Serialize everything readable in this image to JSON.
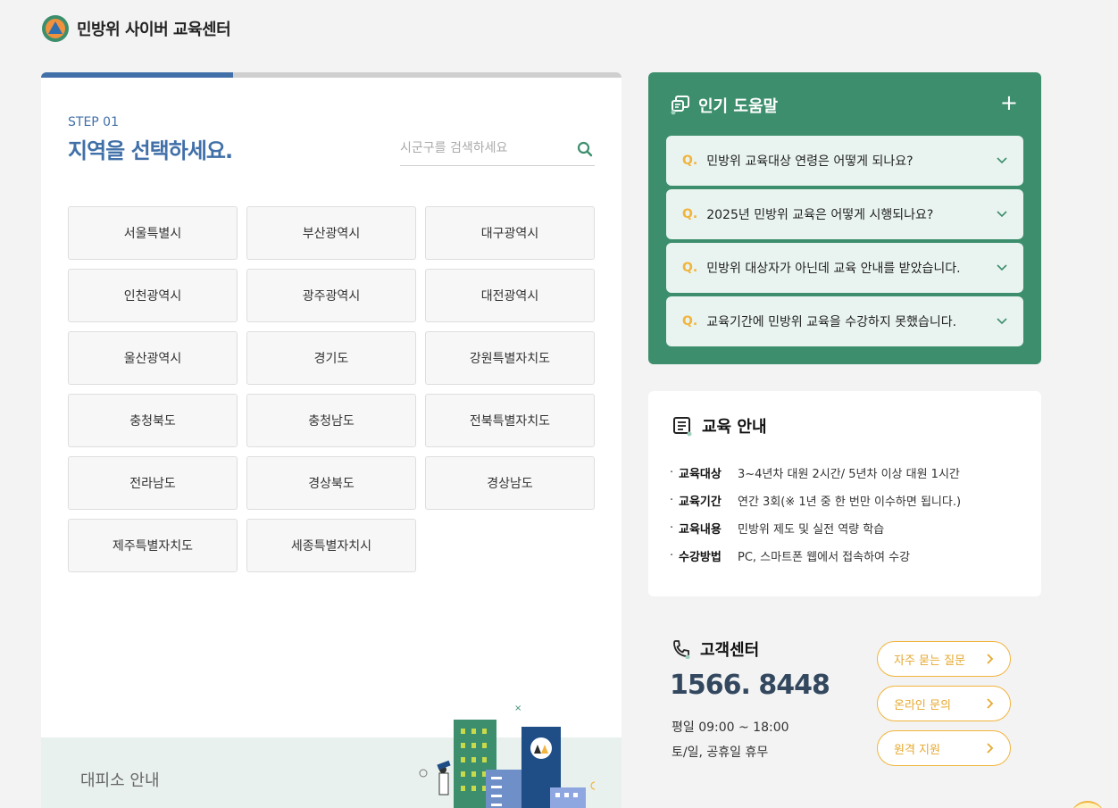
{
  "header": {
    "title": "민방위 사이버 교육센터"
  },
  "step": {
    "label": "STEP 01",
    "title": "지역을 선택하세요.",
    "progress_fraction": 0.33
  },
  "search": {
    "placeholder": "시군구를 검색하세요"
  },
  "regions": [
    "서울특별시",
    "부산광역시",
    "대구광역시",
    "인천광역시",
    "광주광역시",
    "대전광역시",
    "울산광역시",
    "경기도",
    "강원특별자치도",
    "충청북도",
    "충청남도",
    "전북특별자치도",
    "전라남도",
    "경상북도",
    "경상남도",
    "제주특별자치도",
    "세종특별자치시"
  ],
  "office": {
    "label": "대피소 안내"
  },
  "faq": {
    "title": "인기 도움말",
    "q_mark": "Q.",
    "items": [
      "민방위 교육대상 연령은 어떻게 되나요?",
      "2025년 민방위 교육은 어떻게 시행되나요?",
      "민방위 대상자가 아닌데 교육 안내를 받았습니다.",
      "교육기간에 민방위 교육을 수강하지 못했습니다."
    ]
  },
  "edu": {
    "title": "교육 안내",
    "rows": [
      {
        "key": "교육대상",
        "value": "3~4년차 대원 2시간/ 5년차 이상 대원 1시간"
      },
      {
        "key": "교육기간",
        "value": "연간 3회(※ 1년 중 한 번만 이수하면 됩니다.)"
      },
      {
        "key": "교육내용",
        "value": "민방위 제도 및 실전 역량 학습"
      },
      {
        "key": "수강방법",
        "value": "PC, 스마트폰 웹에서 접속하여 수강"
      }
    ]
  },
  "customer": {
    "title": "고객센터",
    "phone": "1566. 8448",
    "hours_weekday": "평일 09:00 ~ 18:00",
    "hours_weekend": "토/일, 공휴일 휴무",
    "links": [
      "자주 묻는 질문",
      "온라인 문의",
      "원격 지원"
    ]
  },
  "colors": {
    "primary_blue": "#4170a8",
    "green": "#3c8e6d",
    "accent_yellow": "#f1b43d"
  }
}
